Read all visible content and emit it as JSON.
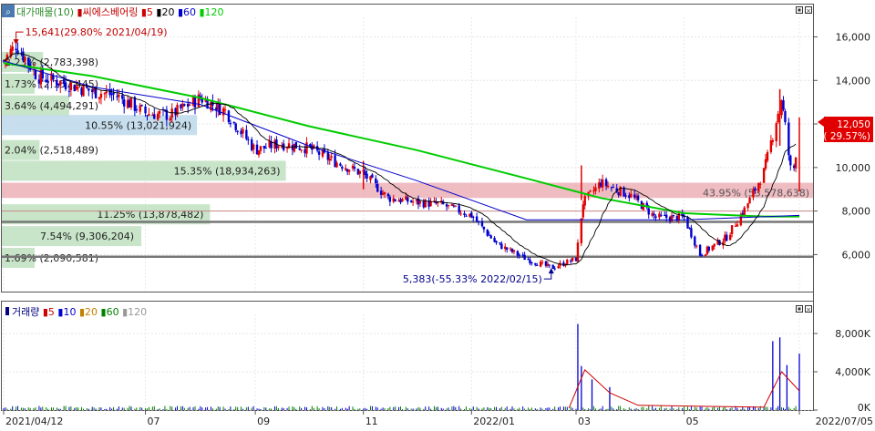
{
  "price_panel": {
    "icon": "magnifier-icon",
    "legend_items": [
      {
        "text": "대가매물(10)",
        "color": "#2a8a2a"
      },
      {
        "text": "씨에스베어링",
        "color": "#c00000"
      },
      {
        "text": "5",
        "color": "#cc0000"
      },
      {
        "text": "20",
        "color": "#000000"
      },
      {
        "text": "60",
        "color": "#0000cc"
      },
      {
        "text": "120",
        "color": "#00cc00"
      }
    ],
    "current_price": "12,050",
    "current_change": "( 29.57%)",
    "high_annotation": "15,641(29.80% 2021/04/19)",
    "low_annotation": "5,383(-55.33% 2022/02/15)",
    "band_label": "43.95% (53,578,638)"
  },
  "volume_panel": {
    "legend_items": [
      {
        "text": "거래량",
        "color": "#000080"
      },
      {
        "text": "5",
        "color": "#cc0000"
      },
      {
        "text": "10",
        "color": "#0000cc"
      },
      {
        "text": "20",
        "color": "#c08000"
      },
      {
        "text": "60",
        "color": "#008000"
      },
      {
        "text": "120",
        "color": "#999999"
      }
    ],
    "y_ticks": [
      "8,000K",
      "4,000K",
      "0K"
    ]
  },
  "x_ticks": [
    "2021/04/12",
    "07",
    "09",
    "11",
    "2022/01",
    "03",
    "05",
    "2022/07/05"
  ],
  "colors": {
    "up": "#e00000",
    "down": "#0000d0",
    "band": "#e8a0a8",
    "profile": "#bfe0bf",
    "profile_blue": "#bcd8ea"
  },
  "chart_data": [
    {
      "type": "candlestick",
      "title": "씨에스베어링",
      "yticks": [
        6000,
        8000,
        10000,
        12000,
        14000,
        16000
      ],
      "ylim": [
        4300,
        16900
      ],
      "x_range": [
        "2021-04-12",
        "2022-07-05"
      ],
      "price_points": [
        [
          "2021-04-12",
          14900
        ],
        [
          "2021-04-19",
          15641
        ],
        [
          "2021-05-01",
          14200
        ],
        [
          "2021-05-15",
          13900
        ],
        [
          "2021-06-01",
          13500
        ],
        [
          "2021-06-15",
          13300
        ],
        [
          "2021-07-01",
          12500
        ],
        [
          "2021-07-15",
          12400
        ],
        [
          "2021-08-01",
          13200
        ],
        [
          "2021-08-15",
          12600
        ],
        [
          "2021-09-01",
          10800
        ],
        [
          "2021-09-15",
          11100
        ],
        [
          "2021-10-01",
          10900
        ],
        [
          "2021-10-15",
          10300
        ],
        [
          "2021-11-01",
          9700
        ],
        [
          "2021-11-15",
          8600
        ],
        [
          "2021-12-01",
          8400
        ],
        [
          "2021-12-15",
          8300
        ],
        [
          "2022-01-01",
          7800
        ],
        [
          "2022-01-15",
          6500
        ],
        [
          "2022-02-01",
          5800
        ],
        [
          "2022-02-15",
          5383
        ],
        [
          "2022-03-01",
          5800
        ],
        [
          "2022-03-05",
          8400
        ],
        [
          "2022-03-15",
          9300
        ],
        [
          "2022-04-01",
          8700
        ],
        [
          "2022-04-15",
          7700
        ],
        [
          "2022-05-01",
          7700
        ],
        [
          "2022-05-10",
          6000
        ],
        [
          "2022-05-25",
          6800
        ],
        [
          "2022-06-05",
          8200
        ],
        [
          "2022-06-15",
          9800
        ],
        [
          "2022-06-25",
          13200
        ],
        [
          "2022-07-01",
          9300
        ],
        [
          "2022-07-05",
          12050
        ]
      ],
      "series": [
        {
          "name": "120",
          "color": "#00cc00",
          "values": [
            [
              "2021-04-12",
              14800
            ],
            [
              "2021-06-01",
              14200
            ],
            [
              "2021-08-01",
              13200
            ],
            [
              "2021-10-01",
              11900
            ],
            [
              "2021-12-01",
              10800
            ],
            [
              "2022-02-01",
              9500
            ],
            [
              "2022-03-15",
              8600
            ],
            [
              "2022-05-01",
              7900
            ],
            [
              "2022-06-15",
              7750
            ],
            [
              "2022-07-05",
              7750
            ]
          ]
        },
        {
          "name": "60",
          "color": "#0000cc",
          "values": [
            [
              "2021-04-12",
              14900
            ],
            [
              "2021-06-01",
              13700
            ],
            [
              "2021-08-01",
              12900
            ],
            [
              "2021-10-01",
              11000
            ],
            [
              "2021-12-01",
              9400
            ],
            [
              "2022-02-01",
              7600
            ],
            [
              "2022-03-15",
              7600
            ],
            [
              "2022-05-01",
              7600
            ],
            [
              "2022-07-05",
              7800
            ]
          ]
        }
      ],
      "horizontal_lines": [
        8000,
        7500,
        5900
      ],
      "band": [
        8600,
        9300
      ],
      "volume_profile": [
        {
          "label": "2.23% (2,783,398)",
          "price": 14850,
          "pct": 2.23
        },
        {
          "label": "1.73% (2,157,445)",
          "price": 13850,
          "pct": 1.73
        },
        {
          "label": "3.64% (4,494,291)",
          "price": 12850,
          "pct": 3.64
        },
        {
          "label": "10.55% (13,021,924)",
          "price": 11950,
          "pct": 10.55
        },
        {
          "label": "2.04% (2,518,489)",
          "price": 10800,
          "pct": 2.04
        },
        {
          "label": "15.35% (18,934,263)",
          "price": 9850,
          "pct": 15.35
        },
        {
          "label": "11.25% (13,878,482)",
          "price": 7850,
          "pct": 11.25
        },
        {
          "label": "7.54% (9,306,204)",
          "price": 6850,
          "pct": 7.54
        },
        {
          "label": "1.69% (2,090,581)",
          "price": 5850,
          "pct": 1.69
        }
      ]
    },
    {
      "type": "bar",
      "title": "거래량",
      "ylabel": "",
      "ylim": [
        0,
        10000
      ],
      "volume_spikes_k": [
        [
          "2022-03-02",
          9000
        ],
        [
          "2022-03-04",
          4600
        ],
        [
          "2022-03-10",
          3200
        ],
        [
          "2022-03-20",
          2400
        ],
        [
          "2022-06-20",
          7200
        ],
        [
          "2022-06-24",
          7600
        ],
        [
          "2022-06-28",
          4700
        ],
        [
          "2022-07-05",
          5900
        ]
      ],
      "ma5_points_k": [
        [
          "2022-02-25",
          200
        ],
        [
          "2022-03-06",
          4200
        ],
        [
          "2022-03-20",
          1800
        ],
        [
          "2022-04-05",
          500
        ],
        [
          "2022-06-15",
          300
        ],
        [
          "2022-06-25",
          4000
        ],
        [
          "2022-07-05",
          2000
        ]
      ]
    }
  ]
}
